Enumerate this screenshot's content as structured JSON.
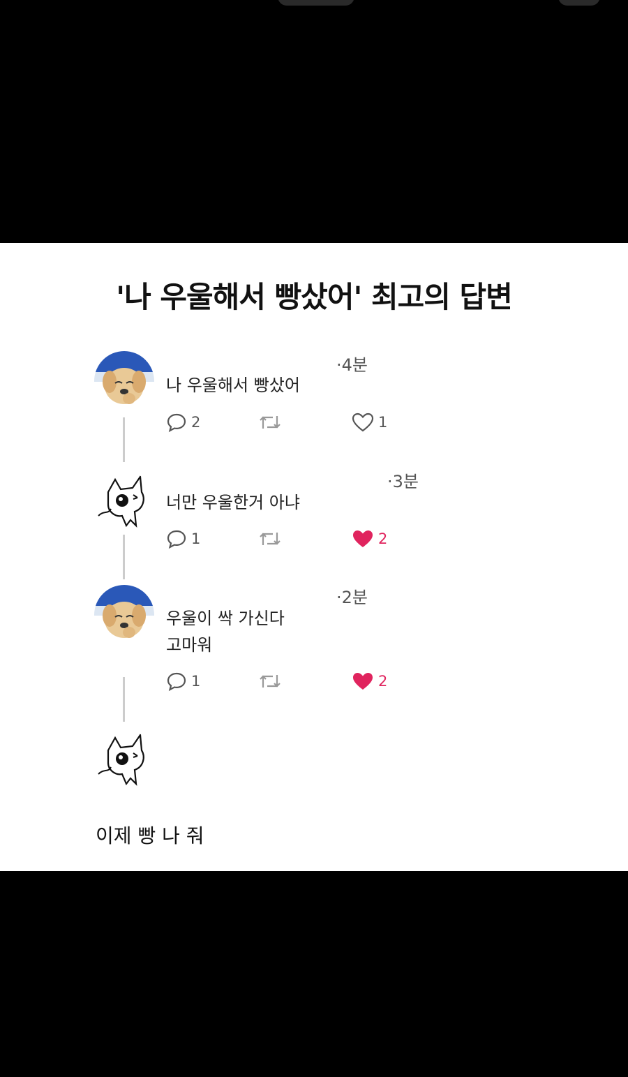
{
  "title": "'나 우울해서 빵샀어' 최고의 답변",
  "posts": [
    {
      "text": "나 우울해서 빵샀어",
      "time": "·4분",
      "replies": "2",
      "likes": "1",
      "liked": false
    },
    {
      "text": "너만 우울한거 아냐",
      "time": "·3분",
      "replies": "1",
      "likes": "2",
      "liked": true
    },
    {
      "text_line1": "우울이 싹 가신다",
      "text_line2": "고마워",
      "time": "·2분",
      "replies": "1",
      "likes": "2",
      "liked": true
    }
  ],
  "final_reply": "이제 빵 나 줘",
  "colors": {
    "like_active": "#e0245e",
    "thread_line": "#cccccc"
  },
  "icons": [
    "reply-icon",
    "retweet-icon",
    "heart-icon",
    "heart-filled-icon",
    "dog-avatar",
    "cat-avatar"
  ]
}
